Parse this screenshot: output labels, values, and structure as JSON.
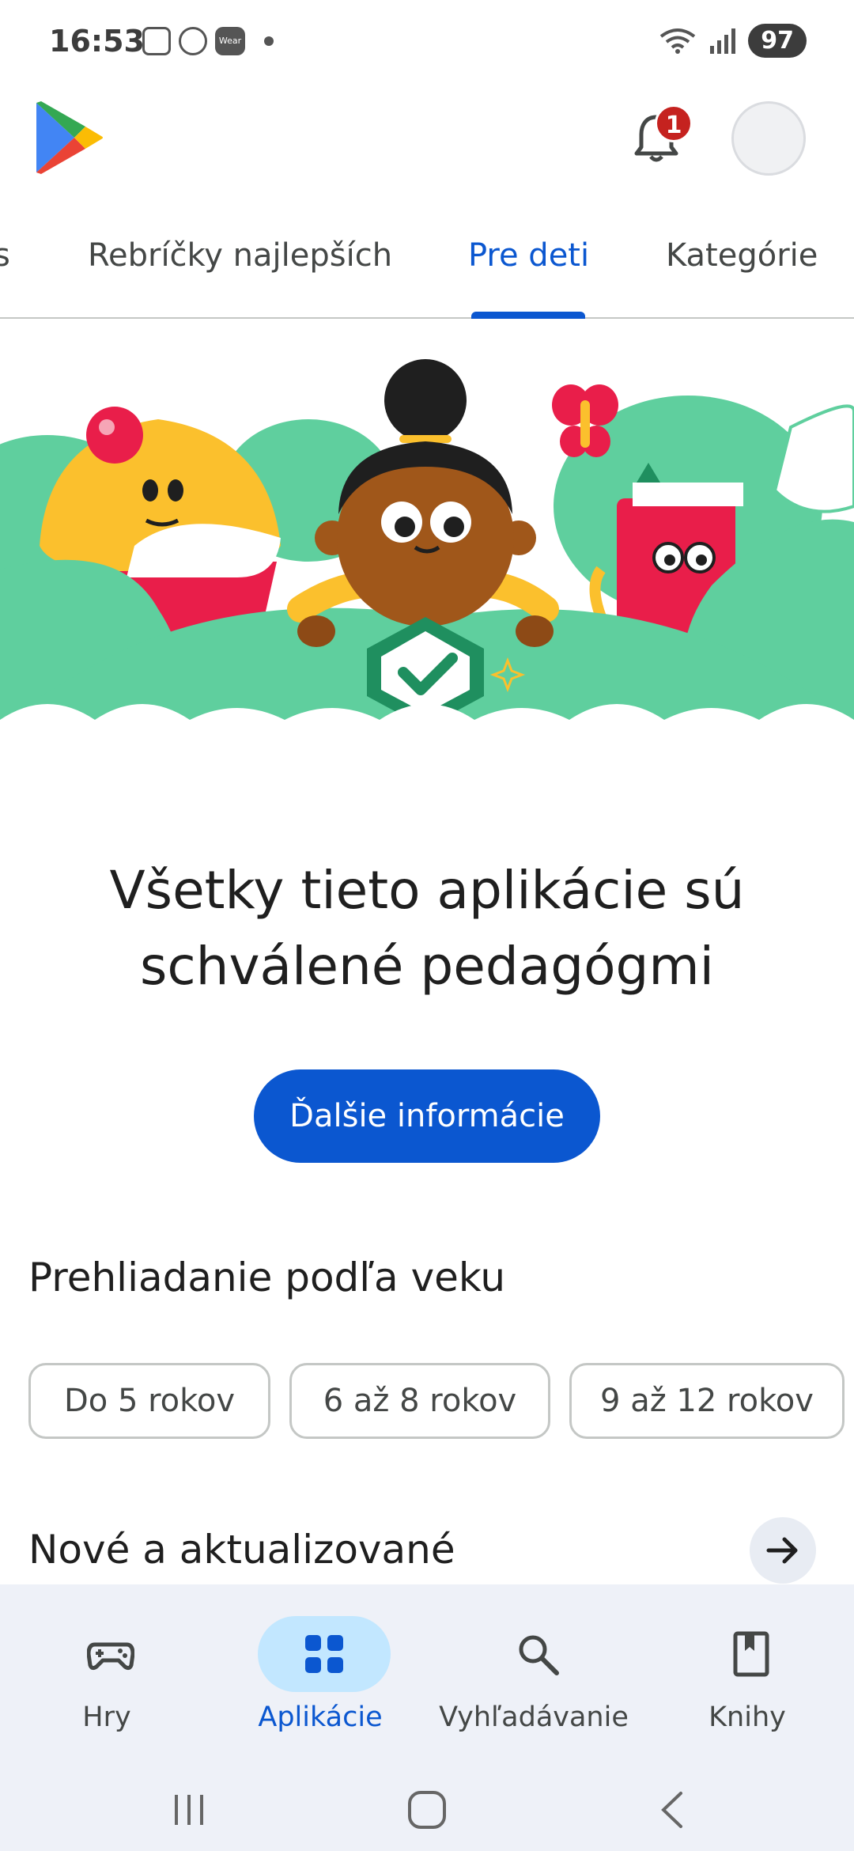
{
  "status_bar": {
    "time": "16:53",
    "battery": "97",
    "wear_label": "Wear"
  },
  "header": {
    "notification_count": "1"
  },
  "tabs": [
    {
      "label": "s"
    },
    {
      "label": "Rebríčky najlepších"
    },
    {
      "label": "Pre deti",
      "active": true
    },
    {
      "label": "Kategórie"
    }
  ],
  "hero": {
    "headline_line1": "Všetky tieto aplikácie sú",
    "headline_line2": "schválené pedagógmi",
    "cta_label": "Ďalšie informácie"
  },
  "age_section": {
    "title": "Prehliadanie podľa veku",
    "chips": [
      "Do 5 rokov",
      "6 až 8 rokov",
      "9 až 12 rokov"
    ]
  },
  "new_section": {
    "title": "Nové a aktualizované"
  },
  "bottom_nav": [
    {
      "label": "Hry",
      "icon": "gamepad-icon"
    },
    {
      "label": "Aplikácie",
      "icon": "apps-grid-icon",
      "active": true
    },
    {
      "label": "Vyhľadávanie",
      "icon": "search-icon"
    },
    {
      "label": "Knihy",
      "icon": "book-icon"
    }
  ],
  "colors": {
    "accent": "#0b57d0",
    "active_pill": "#c2e7ff",
    "nav_bg": "#eef1f8",
    "badge": "#c5221f"
  }
}
